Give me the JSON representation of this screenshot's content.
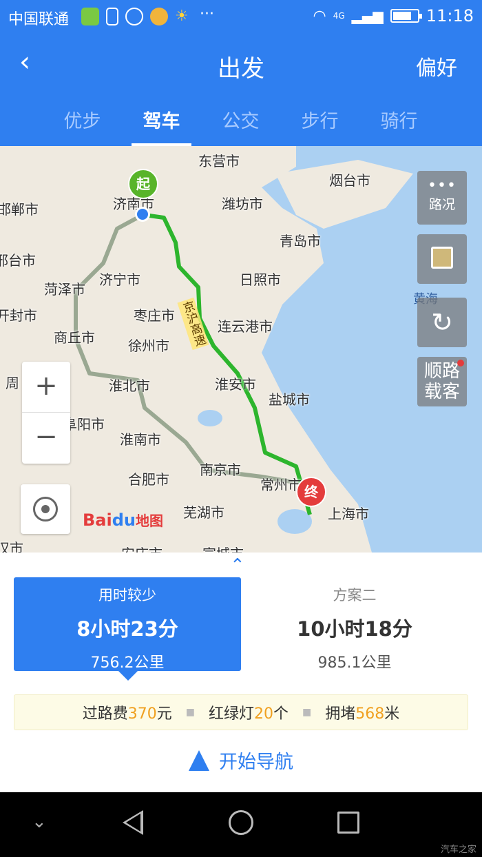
{
  "status_bar": {
    "carrier": "中国联通",
    "network": "4G",
    "time": "11:18"
  },
  "header": {
    "back_icon": "‹",
    "title": "出发",
    "preferences": "偏好"
  },
  "tabs": [
    {
      "label": "优步",
      "active": false
    },
    {
      "label": "驾车",
      "active": true
    },
    {
      "label": "公交",
      "active": false
    },
    {
      "label": "步行",
      "active": false
    },
    {
      "label": "骑行",
      "active": false
    }
  ],
  "map": {
    "start_marker": "起",
    "end_marker": "终",
    "road_label": "京沪高速",
    "sea_label": "黄海",
    "cities": [
      "东营市",
      "烟台市",
      "济南市",
      "潍坊市",
      "邯郸市",
      "青岛市",
      "邢台市",
      "济宁市",
      "日照市",
      "菏泽市",
      "开封市",
      "枣庄市",
      "连云港市",
      "商丘市",
      "徐州市",
      "淮安市",
      "盐城市",
      "周",
      "淮北市",
      "阜阳市",
      "淮南市",
      "南京市",
      "常州市",
      "合肥市",
      "芜湖市",
      "上海市",
      "汉市",
      "安庆市",
      "宣城市"
    ],
    "buttons": {
      "traffic_label": "路况",
      "ride_label_1": "顺路",
      "ride_label_2": "载客"
    },
    "zoom_in": "+",
    "zoom_out": "−",
    "logo_text_1": "Bai",
    "logo_text_2": "du",
    "logo_text_3": "地图"
  },
  "plans": [
    {
      "label": "用时较少",
      "time": "8小时23分",
      "distance": "756.2公里",
      "selected": true
    },
    {
      "label": "方案二",
      "time": "10小时18分",
      "distance": "985.1公里",
      "selected": false
    }
  ],
  "info": {
    "toll_prefix": "过路费",
    "toll_value": "370",
    "toll_unit": "元",
    "lights_prefix": "红绿灯",
    "lights_value": "20",
    "lights_unit": "个",
    "jam_prefix": "拥堵",
    "jam_value": "568",
    "jam_unit": "米"
  },
  "start_navigation": "开始导航",
  "watermark": "汽车之家",
  "colors": {
    "primary": "#2f7ff0",
    "route": "#2db52d",
    "highlight": "#f0a020"
  }
}
